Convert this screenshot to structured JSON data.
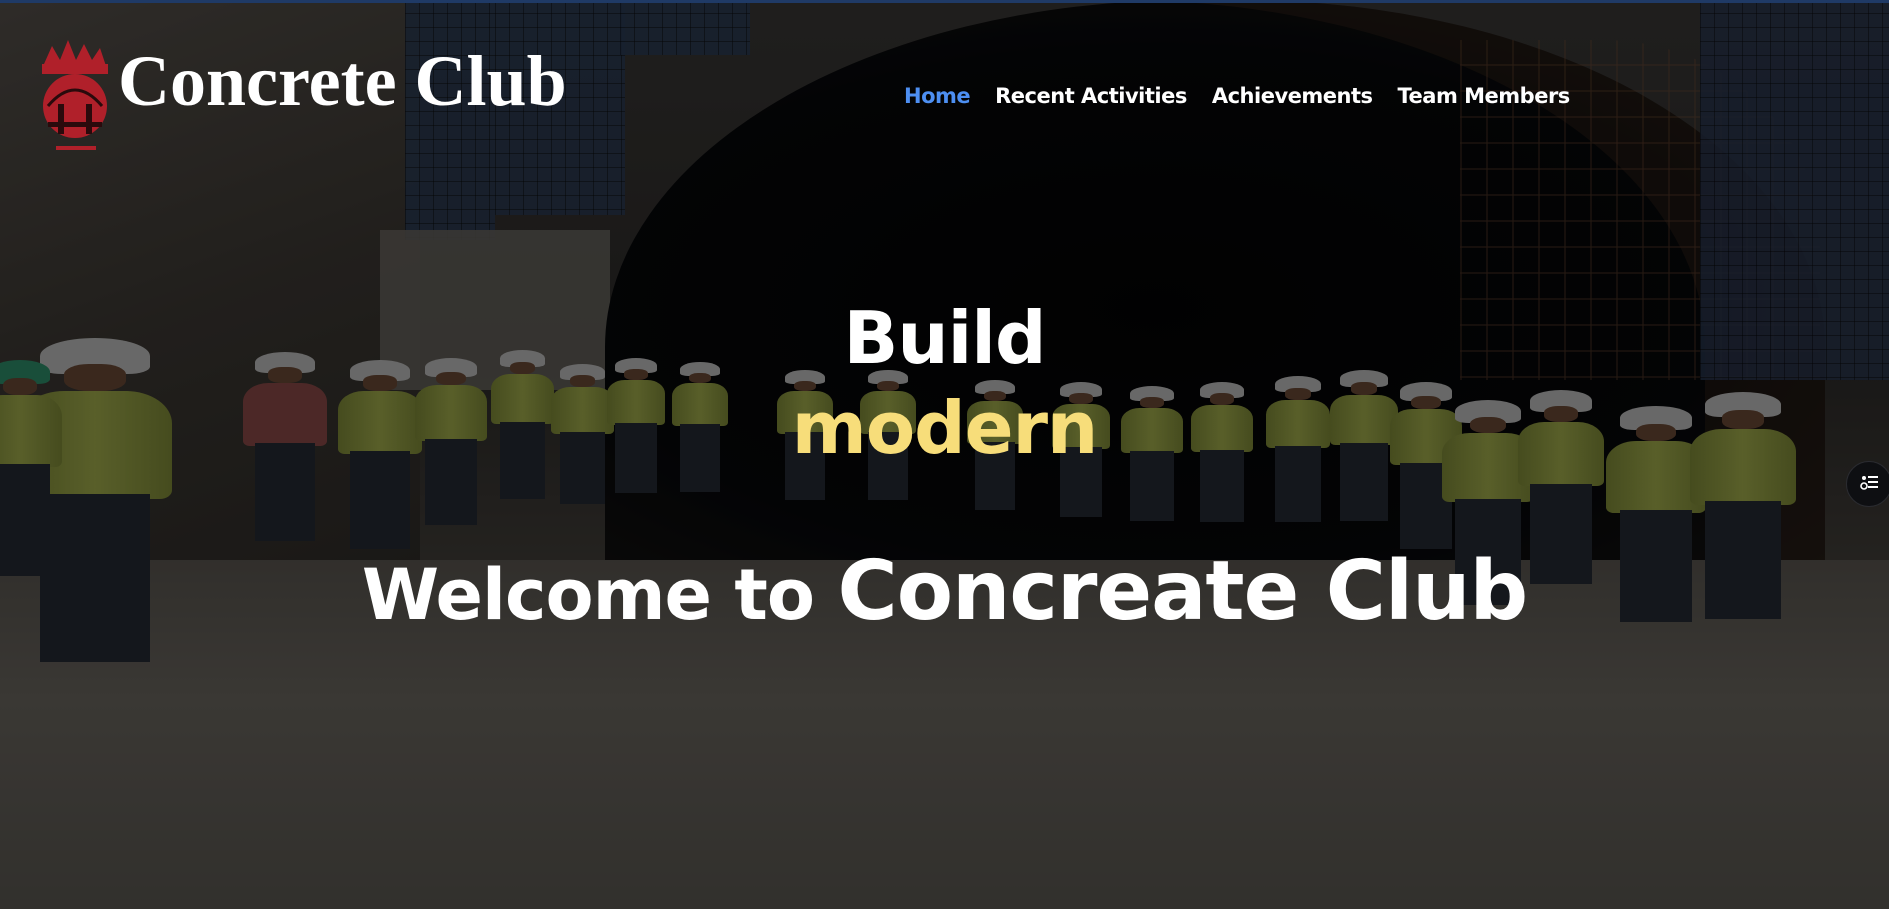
{
  "site": {
    "title": "Concrete Club",
    "logo_icon": "club-emblem-icon"
  },
  "nav": {
    "items": [
      {
        "label": "Home",
        "active": true
      },
      {
        "label": "Recent Activities",
        "active": false
      },
      {
        "label": "Achievements",
        "active": false
      },
      {
        "label": "Team Members",
        "active": false
      }
    ],
    "active_color": "#4d8ff2"
  },
  "hero": {
    "line1": "Build",
    "line2": "modern",
    "line2_color": "#f7dd7a",
    "welcome_prefix": "Welcome to",
    "welcome_name": "Concreate Club",
    "background": "group-photo-tunnel-site"
  },
  "floating": {
    "icon": "accessibility-menu-icon"
  }
}
